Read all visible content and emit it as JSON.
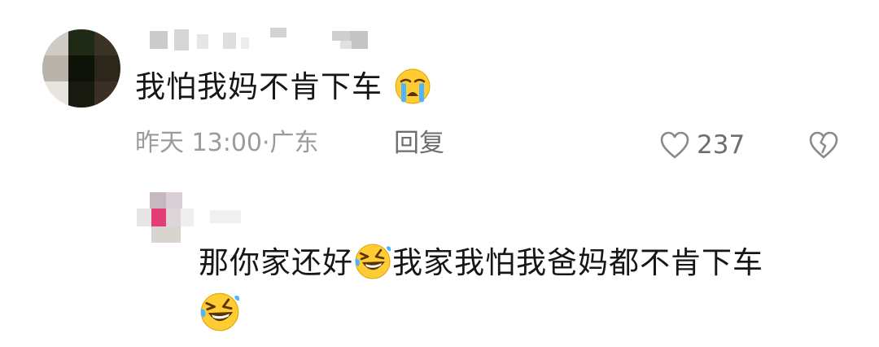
{
  "comment": {
    "text": "我怕我妈不肯下车",
    "emoji": "loudly-crying-face-emoji",
    "time": "昨天 13:00",
    "separator": "·",
    "location": "广东",
    "reply_label": "回复",
    "like_count": "237",
    "colors": {
      "text": "#161616",
      "meta": "#9b9b9b",
      "action": "#6e6e6e"
    }
  },
  "reply": {
    "text_part1": "那你家还好",
    "emoji1": "rolling-on-floor-laughing-emoji",
    "text_part2": "我家我怕我爸妈都不肯下车",
    "emoji2": "rolling-on-floor-laughing-emoji"
  }
}
